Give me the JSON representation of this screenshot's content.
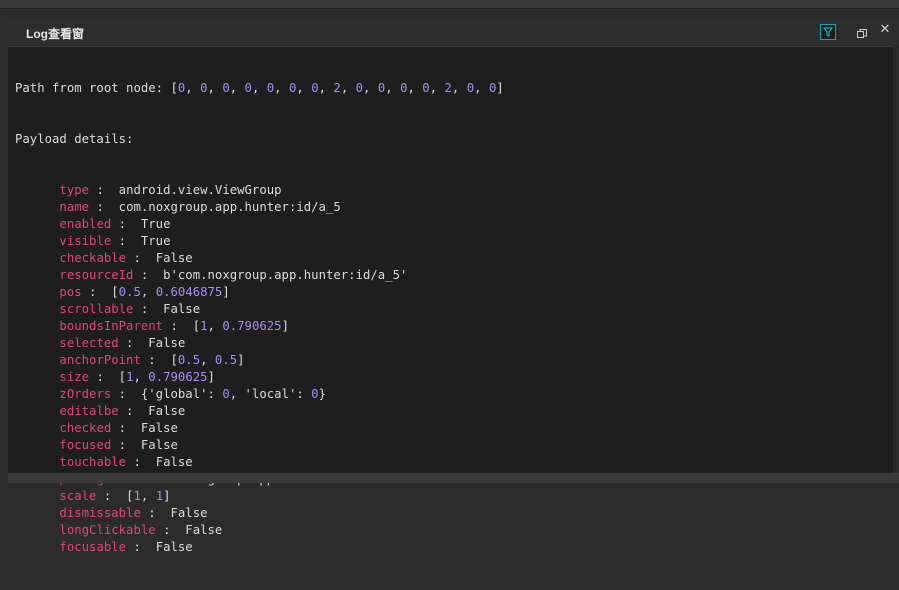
{
  "window": {
    "title": "Log查看窗"
  },
  "toolbar": {
    "filter_icon": "filter-icon",
    "restore_icon": "restore-window-icon",
    "close_icon": "close-icon",
    "close_glyph": "✕"
  },
  "log": {
    "path_line": "Path from root node: [0, 0, 0, 0, 0, 0, 0, 2, 0, 0, 0, 0, 2, 0, 0]",
    "payload_header": "Payload details:",
    "fields": [
      {
        "key": "type",
        "value": "android.view.ViewGroup"
      },
      {
        "key": "name",
        "value": "com.noxgroup.app.hunter:id/a_5"
      },
      {
        "key": "enabled",
        "value": "True"
      },
      {
        "key": "visible",
        "value": "True"
      },
      {
        "key": "checkable",
        "value": "False"
      },
      {
        "key": "resourceId",
        "value": "b'com.noxgroup.app.hunter:id/a_5'"
      },
      {
        "key": "pos",
        "value": "[0.5, 0.6046875]"
      },
      {
        "key": "scrollable",
        "value": "False"
      },
      {
        "key": "boundsInParent",
        "value": "[1, 0.790625]"
      },
      {
        "key": "selected",
        "value": "False"
      },
      {
        "key": "anchorPoint",
        "value": "[0.5, 0.5]"
      },
      {
        "key": "size",
        "value": "[1, 0.790625]"
      },
      {
        "key": "zOrders",
        "value": "{'global': 0, 'local': 0}"
      },
      {
        "key": "editalbe",
        "value": "False"
      },
      {
        "key": "checked",
        "value": "False"
      },
      {
        "key": "focused",
        "value": "False"
      },
      {
        "key": "touchable",
        "value": "False"
      },
      {
        "key": "package",
        "value": "b'com.noxgroup.app.hunter'"
      },
      {
        "key": "scale",
        "value": "[1, 1]"
      },
      {
        "key": "dismissable",
        "value": "False"
      },
      {
        "key": "longClickable",
        "value": "False"
      },
      {
        "key": "focusable",
        "value": "False"
      }
    ]
  },
  "colors": {
    "key": "#e0457b",
    "number": "#a98bf2",
    "text": "#dcdcdc",
    "accent": "#19a7b5"
  }
}
